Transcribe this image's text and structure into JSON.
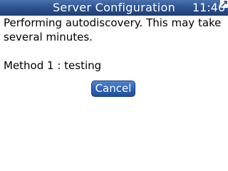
{
  "titlebar": {
    "title": "Server Configuration",
    "time": "11:46",
    "corner_icon": "expand-arrow-icon"
  },
  "message": {
    "text": "Performing autodiscovery.  This may take several minutes."
  },
  "status": {
    "text": "Method 1 : testing"
  },
  "buttons": {
    "cancel_label": "Cancel"
  },
  "colors": {
    "titlebar": "#2a4f8c",
    "button": "#2c61b3",
    "background": "#ffffff"
  }
}
